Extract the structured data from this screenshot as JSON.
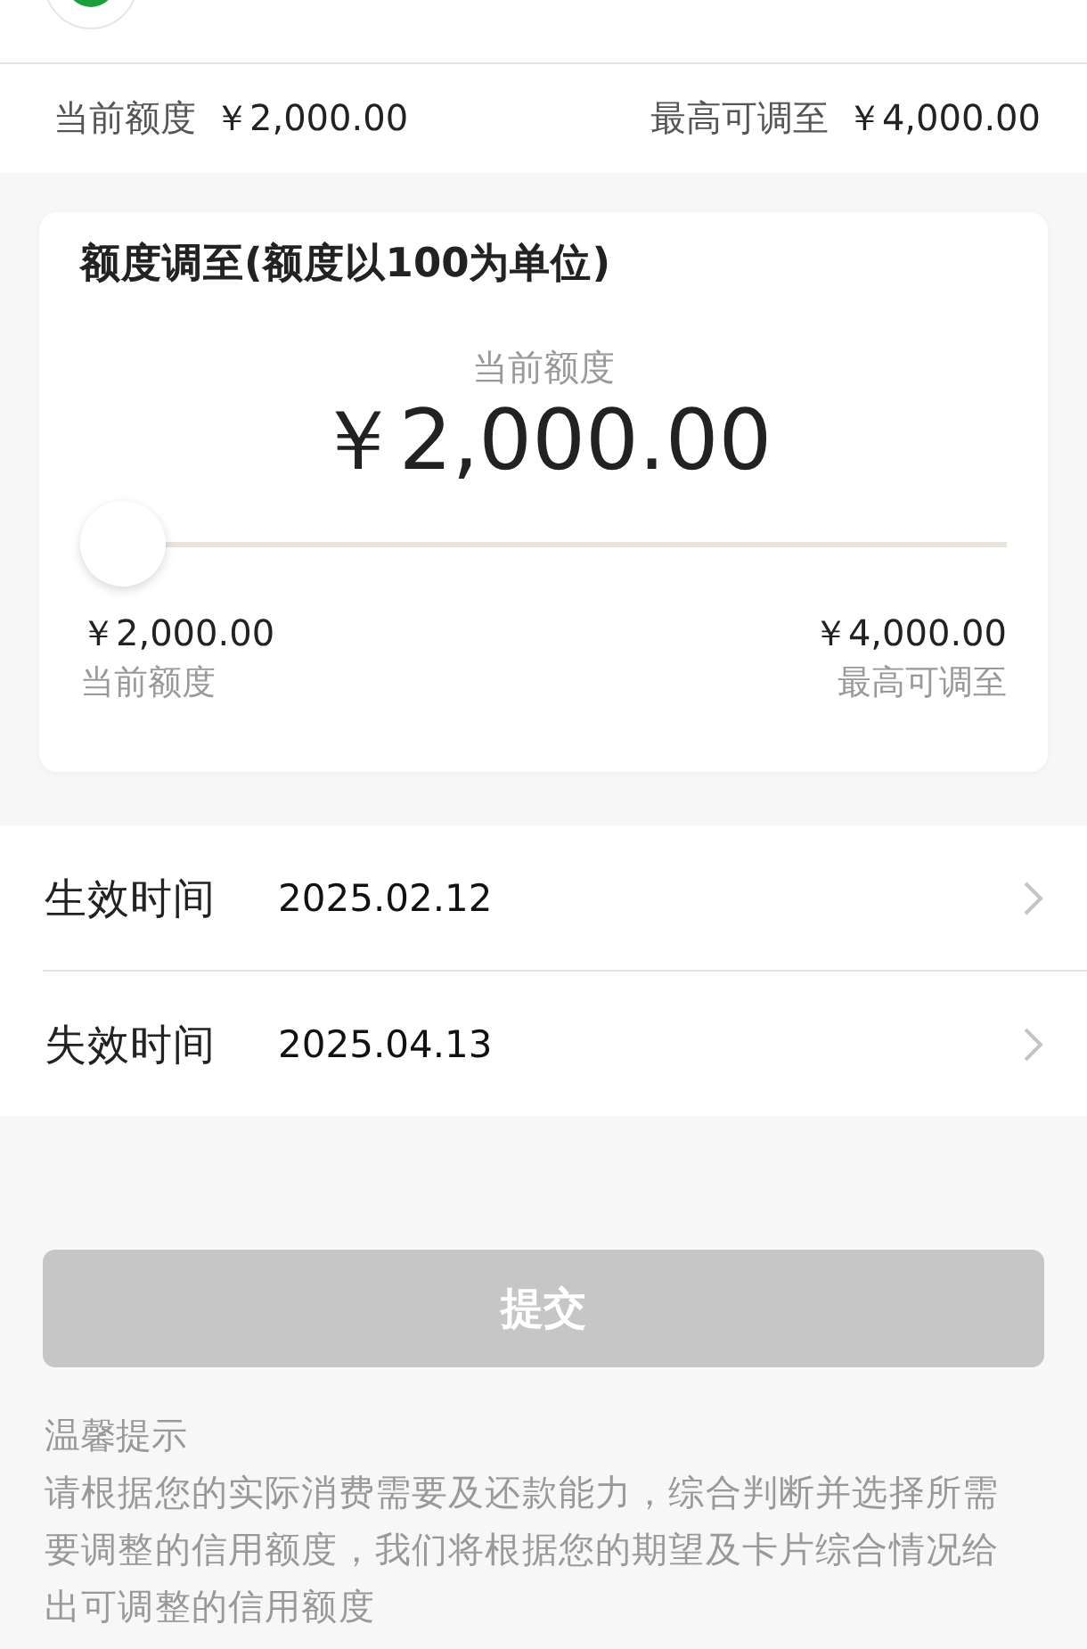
{
  "summary": {
    "current_label": "当前额度",
    "current_value": "￥2,000.00",
    "max_label": "最高可调至",
    "max_value": "￥4,000.00"
  },
  "adjust_card": {
    "title": "额度调至(额度以100为单位)",
    "amount_label": "当前额度",
    "amount": "￥2,000.00",
    "slider": {
      "level": 0
    },
    "min": {
      "value": "￥2,000.00",
      "label": "当前额度"
    },
    "max": {
      "value": "￥4,000.00",
      "label": "最高可调至"
    }
  },
  "dates": [
    {
      "label": "生效时间",
      "value": "2025.02.12"
    },
    {
      "label": "失效时间",
      "value": "2025.04.13"
    }
  ],
  "submit_button": {
    "label": "提交",
    "disabled": true
  },
  "tips": {
    "title": "温馨提示",
    "text": "请根据您的实际消费需要及还款能力，综合判断并选择所需要调整的信用额度，我们将根据您的期望及卡片综合情况给出可调整的信用额度"
  }
}
